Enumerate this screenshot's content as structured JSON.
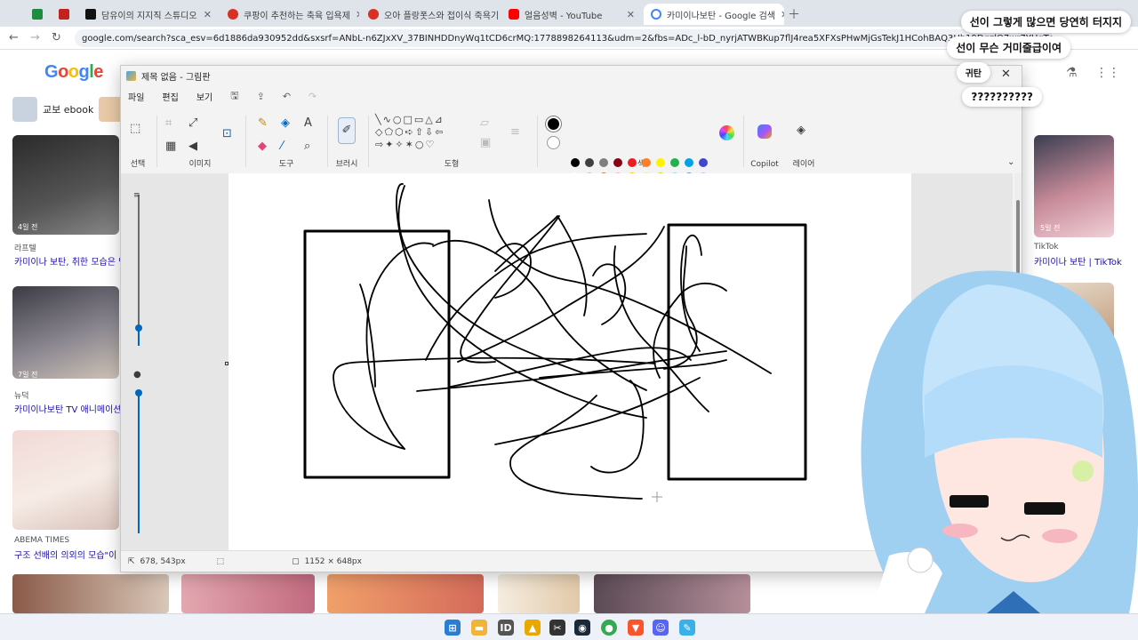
{
  "browser": {
    "tabs": [
      {
        "title": "",
        "color": "#1e8e3e"
      },
      {
        "title": "",
        "color": "#c5221f"
      },
      {
        "title": "담유이의 지지직 스튜디오",
        "color": "#111111"
      },
      {
        "title": "쿠팡이 추천하는 축육 입욕제",
        "color": "#d93025"
      },
      {
        "title": "오아 플랑폿스와 접이식 죽욕기",
        "color": "#d93025"
      },
      {
        "title": "얼음성벽 - YouTube",
        "color": "#ff0000"
      },
      {
        "title": "카미이나보탄 - Google 검색",
        "color": "#4285f4"
      }
    ],
    "url": "google.com/search?sca_esv=6d1886da930952dd&sxsrf=ANbL-n6ZJxXV_37BINHDDnyWq1tCD6crMQ:1778898264113&udm=2&fbs=ADc_l-bD_nyrjATWBKup7flJ4rea5XFXsPHwMjGsTekJ1HCohBAQ3Hh19DqzlO7wr7YUgTdA6AlvvuoUB..."
  },
  "google": {
    "logo": "Google",
    "chip_label": "교보 ebook",
    "results_left": [
      {
        "ago": "4일 전",
        "source": "라프텔",
        "title": "카미이나 보탄, 취한 모습은 백"
      },
      {
        "ago": "7일 전",
        "source": "뉴덕",
        "title": "카미이나보탄 TV 애니메이션"
      },
      {
        "ago": "",
        "source": "ABEMA TIMES",
        "title": "구조 선배의 의외의 모습\"이 밝"
      }
    ],
    "result_right": {
      "ago": "5일 전",
      "source": "TikTok",
      "title": "카미이나 보탄 | TikTok"
    }
  },
  "paint": {
    "title": "제목 없음 - 그림판",
    "menu": [
      "파일",
      "편집",
      "보기"
    ],
    "groups": [
      "선택",
      "이미지",
      "도구",
      "브러시",
      "도형",
      "색",
      "Copilot",
      "레이어"
    ],
    "colors_row1": [
      "#000000",
      "#404040",
      "#7f7f7f",
      "#880015",
      "#ed1c24",
      "#ff7f27",
      "#fff200",
      "#22b14c",
      "#00a2e8",
      "#3f48cc",
      "#a349a4",
      "#a349a4"
    ],
    "colors_row2": [
      "#ffffff",
      "#c3c3c3",
      "#b97a57",
      "#ffaec9",
      "#ffc90e",
      "#efe4b0",
      "#b5e61d",
      "#99d9ea",
      "#7092be",
      "#c8bfe7"
    ],
    "status_cursor": "678, 543px",
    "status_canvas": "1152 × 648px"
  },
  "chat": [
    "선이 그렇게 많으면 당연히 터지지",
    "선이 무슨 거미줄급이여",
    "귀탄",
    "??????????"
  ],
  "taskbar": {
    "apps": [
      "windows-start",
      "file-explorer",
      "id-app",
      "acrobat",
      "snipping",
      "steam",
      "chrome",
      "brave",
      "discord",
      "paint"
    ]
  }
}
